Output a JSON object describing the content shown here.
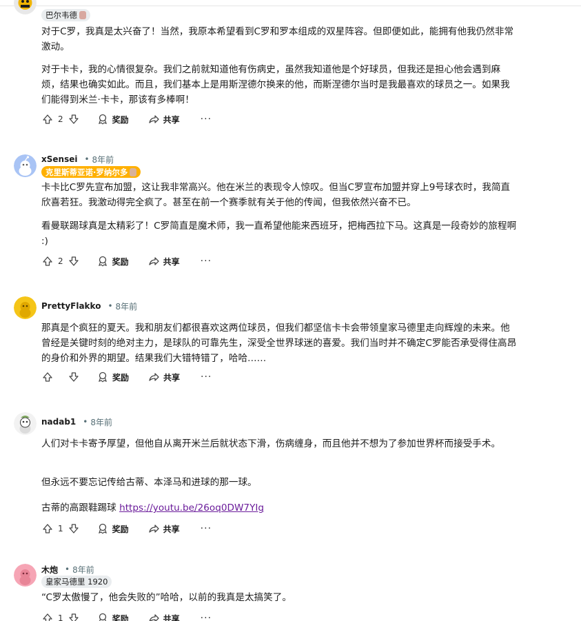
{
  "comments": [
    {
      "author": "巴尔韦德",
      "flair": "巴尔韦德",
      "paragraphs": [
        "对于C罗，我真是太兴奋了！当然，我原本希望看到C罗和罗本组成的双星阵容。但即便如此，能拥有他我仍然非常激动。",
        "对于卡卡，我的心情很复杂。我们之前就知道他有伤病史，虽然我知道他是个好球员，但我还是担心他会遇到麻烦，结果也确实如此。而且，我们基本上是用斯涅德尔换来的他，而斯涅德尔当时是我最喜欢的球员之一。如果我们能得到米兰·卡卡，那该有多棒啊！"
      ],
      "votes": "2",
      "award": "奖励",
      "share": "共享",
      "more": "···"
    },
    {
      "author": "xSensei",
      "time": "8年前",
      "flair": "克里斯蒂亚诺·罗纳尔多",
      "paragraphs": [
        "卡卡比C罗先宣布加盟，这让我非常高兴。他在米兰的表现令人惊叹。但当C罗宣布加盟并穿上9号球衣时，我简直欣喜若狂。我激动得完全疯了。甚至在前一个赛季就有关于他的传闻，但我依然兴奋不已。",
        "看曼联踢球真是太精彩了！C罗简直是魔术师，我一直希望他能来西班牙，把梅西拉下马。这真是一段奇妙的旅程啊 :)"
      ],
      "votes": "2",
      "award": "奖励",
      "share": "共享",
      "more": "···"
    },
    {
      "author": "PrettyFlakko",
      "time": "8年前",
      "paragraphs": [
        "那真是个疯狂的夏天。我和朋友们都很喜欢这两位球员，但我们都坚信卡卡会带领皇家马德里走向辉煌的未来。他曾经是关键时刻的绝对主力，是球队的可靠先生，深受全世界球迷的喜爱。我们当时并不确定C罗能否承受得住高昂的身价和外界的期望。结果我们大错特错了，哈哈……"
      ],
      "votes": "",
      "award": "奖励",
      "share": "共享",
      "more": "···"
    },
    {
      "author": "nadab1",
      "time": "8年前",
      "paragraphs": [
        "人们对卡卡寄予厚望，但他自从离开米兰后就状态下滑，伤病缠身，而且他并不想为了参加世界杯而接受手术。",
        "但永远不要忘记传给古蒂、本泽马和进球的那一球。",
        "古蒂的高跟鞋踢球"
      ],
      "link": "https://youtu.be/26oq0DW7YIg",
      "votes": "1",
      "award": "奖励",
      "share": "共享",
      "more": "···"
    },
    {
      "author": "木炮",
      "time": "8年前",
      "flair": "皇家马德里 1920",
      "paragraphs": [
        "“C罗太傲慢了，他会失败的”哈哈，以前的我真是太搞笑了。"
      ],
      "votes": "1",
      "award": "奖励",
      "share": "共享",
      "more": "···"
    }
  ],
  "colors": {
    "flair_orange": "#ffb000",
    "link": "#6a1b9a",
    "meta_gray": "#576f76"
  }
}
